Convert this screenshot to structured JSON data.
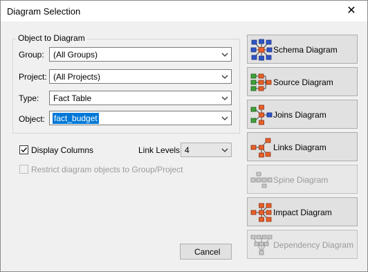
{
  "window": {
    "title": "Diagram Selection",
    "close_glyph": "✕"
  },
  "object_group": {
    "legend": "Object to Diagram",
    "fields": [
      {
        "label": "Group:",
        "value": "(All Groups)"
      },
      {
        "label": "Project:",
        "value": "(All Projects)"
      },
      {
        "label": "Type:",
        "value": "Fact Table"
      },
      {
        "label": "Object:",
        "value": "fact_budget"
      }
    ]
  },
  "options": {
    "display_columns": {
      "label": "Display Columns",
      "checked": true
    },
    "link_levels": {
      "label": "Link Levels:",
      "value": "4"
    },
    "restrict": {
      "label": "Restrict diagram objects to Group/Project",
      "checked": false,
      "enabled": false
    }
  },
  "buttons": {
    "cancel": "Cancel",
    "diagrams": [
      {
        "label": "Schema Diagram",
        "icon": "schema-diagram-icon",
        "enabled": true
      },
      {
        "label": "Source Diagram",
        "icon": "source-diagram-icon",
        "enabled": true
      },
      {
        "label": "Joins Diagram",
        "icon": "joins-diagram-icon",
        "enabled": true
      },
      {
        "label": "Links Diagram",
        "icon": "links-diagram-icon",
        "enabled": true
      },
      {
        "label": "Spine Diagram",
        "icon": "spine-diagram-icon",
        "enabled": false
      },
      {
        "label": "Impact Diagram",
        "icon": "impact-diagram-icon",
        "enabled": true
      },
      {
        "label": "Dependency Diagram",
        "icon": "dependency-diagram-icon",
        "enabled": false
      }
    ]
  },
  "colors": {
    "selection": "#0078d7",
    "icon_blue": "#2f55c8",
    "icon_orange": "#e8602a",
    "icon_green": "#3fa33a",
    "icon_gray": "#a8a8a8"
  }
}
